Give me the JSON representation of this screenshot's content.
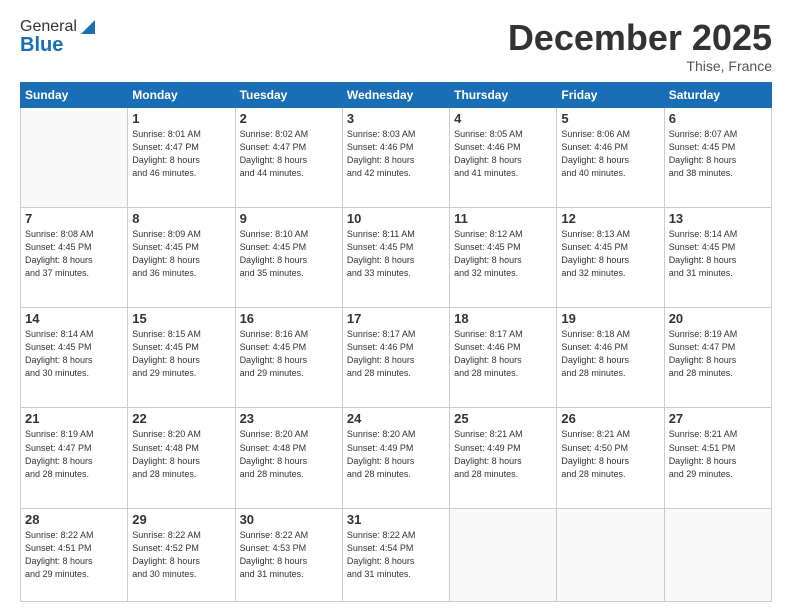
{
  "header": {
    "logo_general": "General",
    "logo_blue": "Blue",
    "month_title": "December 2025",
    "location": "Thise, France"
  },
  "days_of_week": [
    "Sunday",
    "Monday",
    "Tuesday",
    "Wednesday",
    "Thursday",
    "Friday",
    "Saturday"
  ],
  "weeks": [
    [
      {
        "day": "",
        "info": ""
      },
      {
        "day": "1",
        "info": "Sunrise: 8:01 AM\nSunset: 4:47 PM\nDaylight: 8 hours\nand 46 minutes."
      },
      {
        "day": "2",
        "info": "Sunrise: 8:02 AM\nSunset: 4:47 PM\nDaylight: 8 hours\nand 44 minutes."
      },
      {
        "day": "3",
        "info": "Sunrise: 8:03 AM\nSunset: 4:46 PM\nDaylight: 8 hours\nand 42 minutes."
      },
      {
        "day": "4",
        "info": "Sunrise: 8:05 AM\nSunset: 4:46 PM\nDaylight: 8 hours\nand 41 minutes."
      },
      {
        "day": "5",
        "info": "Sunrise: 8:06 AM\nSunset: 4:46 PM\nDaylight: 8 hours\nand 40 minutes."
      },
      {
        "day": "6",
        "info": "Sunrise: 8:07 AM\nSunset: 4:45 PM\nDaylight: 8 hours\nand 38 minutes."
      }
    ],
    [
      {
        "day": "7",
        "info": "Sunrise: 8:08 AM\nSunset: 4:45 PM\nDaylight: 8 hours\nand 37 minutes."
      },
      {
        "day": "8",
        "info": "Sunrise: 8:09 AM\nSunset: 4:45 PM\nDaylight: 8 hours\nand 36 minutes."
      },
      {
        "day": "9",
        "info": "Sunrise: 8:10 AM\nSunset: 4:45 PM\nDaylight: 8 hours\nand 35 minutes."
      },
      {
        "day": "10",
        "info": "Sunrise: 8:11 AM\nSunset: 4:45 PM\nDaylight: 8 hours\nand 33 minutes."
      },
      {
        "day": "11",
        "info": "Sunrise: 8:12 AM\nSunset: 4:45 PM\nDaylight: 8 hours\nand 32 minutes."
      },
      {
        "day": "12",
        "info": "Sunrise: 8:13 AM\nSunset: 4:45 PM\nDaylight: 8 hours\nand 32 minutes."
      },
      {
        "day": "13",
        "info": "Sunrise: 8:14 AM\nSunset: 4:45 PM\nDaylight: 8 hours\nand 31 minutes."
      }
    ],
    [
      {
        "day": "14",
        "info": "Sunrise: 8:14 AM\nSunset: 4:45 PM\nDaylight: 8 hours\nand 30 minutes."
      },
      {
        "day": "15",
        "info": "Sunrise: 8:15 AM\nSunset: 4:45 PM\nDaylight: 8 hours\nand 29 minutes."
      },
      {
        "day": "16",
        "info": "Sunrise: 8:16 AM\nSunset: 4:45 PM\nDaylight: 8 hours\nand 29 minutes."
      },
      {
        "day": "17",
        "info": "Sunrise: 8:17 AM\nSunset: 4:46 PM\nDaylight: 8 hours\nand 28 minutes."
      },
      {
        "day": "18",
        "info": "Sunrise: 8:17 AM\nSunset: 4:46 PM\nDaylight: 8 hours\nand 28 minutes."
      },
      {
        "day": "19",
        "info": "Sunrise: 8:18 AM\nSunset: 4:46 PM\nDaylight: 8 hours\nand 28 minutes."
      },
      {
        "day": "20",
        "info": "Sunrise: 8:19 AM\nSunset: 4:47 PM\nDaylight: 8 hours\nand 28 minutes."
      }
    ],
    [
      {
        "day": "21",
        "info": "Sunrise: 8:19 AM\nSunset: 4:47 PM\nDaylight: 8 hours\nand 28 minutes."
      },
      {
        "day": "22",
        "info": "Sunrise: 8:20 AM\nSunset: 4:48 PM\nDaylight: 8 hours\nand 28 minutes."
      },
      {
        "day": "23",
        "info": "Sunrise: 8:20 AM\nSunset: 4:48 PM\nDaylight: 8 hours\nand 28 minutes."
      },
      {
        "day": "24",
        "info": "Sunrise: 8:20 AM\nSunset: 4:49 PM\nDaylight: 8 hours\nand 28 minutes."
      },
      {
        "day": "25",
        "info": "Sunrise: 8:21 AM\nSunset: 4:49 PM\nDaylight: 8 hours\nand 28 minutes."
      },
      {
        "day": "26",
        "info": "Sunrise: 8:21 AM\nSunset: 4:50 PM\nDaylight: 8 hours\nand 28 minutes."
      },
      {
        "day": "27",
        "info": "Sunrise: 8:21 AM\nSunset: 4:51 PM\nDaylight: 8 hours\nand 29 minutes."
      }
    ],
    [
      {
        "day": "28",
        "info": "Sunrise: 8:22 AM\nSunset: 4:51 PM\nDaylight: 8 hours\nand 29 minutes."
      },
      {
        "day": "29",
        "info": "Sunrise: 8:22 AM\nSunset: 4:52 PM\nDaylight: 8 hours\nand 30 minutes."
      },
      {
        "day": "30",
        "info": "Sunrise: 8:22 AM\nSunset: 4:53 PM\nDaylight: 8 hours\nand 31 minutes."
      },
      {
        "day": "31",
        "info": "Sunrise: 8:22 AM\nSunset: 4:54 PM\nDaylight: 8 hours\nand 31 minutes."
      },
      {
        "day": "",
        "info": ""
      },
      {
        "day": "",
        "info": ""
      },
      {
        "day": "",
        "info": ""
      }
    ]
  ]
}
